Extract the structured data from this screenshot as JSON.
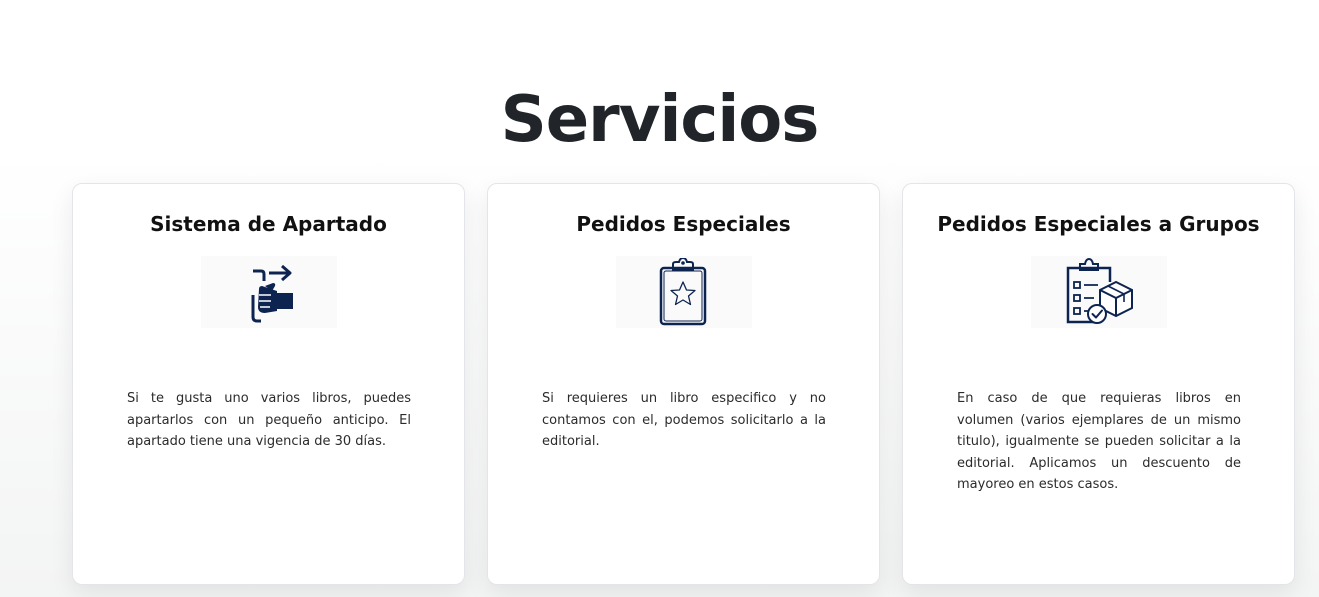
{
  "section": {
    "title": "Servicios"
  },
  "cards": [
    {
      "title": "Sistema de Apartado",
      "icon": "hand-hold-arrow-icon",
      "description": "Si te gusta uno varios libros, puedes apartarlos con un pequeño anticipo. El apartado tiene una vigencia de 30 días."
    },
    {
      "title": "Pedidos Especiales",
      "icon": "clipboard-star-icon",
      "description": "Si requieres un libro especifico y no contamos con el, podemos solicitarlo a la editorial."
    },
    {
      "title": "Pedidos Especiales a Grupos",
      "icon": "checklist-boxes-icon",
      "description": "En caso de que requieras libros en volumen (varios ejemplares de un mismo titulo), igualmente se pueden solicitar a la editorial. Aplicamos un descuento de mayoreo en estos casos."
    }
  ],
  "colors": {
    "icon": "#0d2451",
    "title": "#212529",
    "card_border": "#e3e5e8"
  }
}
